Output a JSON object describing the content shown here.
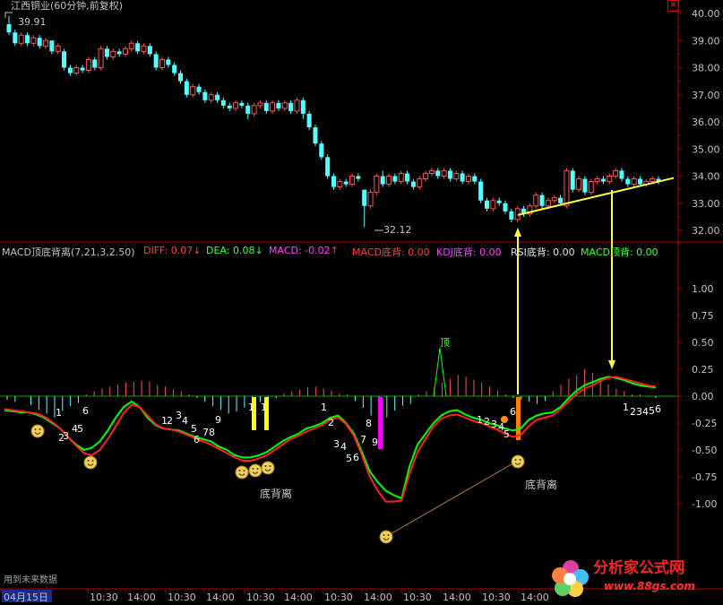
{
  "header": {
    "stock_title": "江西铜业(60分钟,前复权)",
    "close_symbol": "×"
  },
  "price_axis": [
    "40.00",
    "39.00",
    "38.00",
    "37.00",
    "36.00",
    "35.00",
    "34.00",
    "33.00",
    "32.00"
  ],
  "macd_axis": [
    "1.00",
    "0.75",
    "0.50",
    "0.25",
    "0.00",
    "-0.25",
    "-0.50",
    "-0.75",
    "-1.00"
  ],
  "time_axis": [
    "04月15日",
    "10:30",
    "14:00",
    "10:30",
    "14:00",
    "10:30",
    "14:00",
    "10:30",
    "14:00",
    "10:30",
    "14:00",
    "10:30",
    "14:00"
  ],
  "annotations": {
    "high_label": "39.91",
    "low_label": "32.12",
    "top_mark": "顶",
    "divergence_1": "底背离",
    "divergence_2": "底背离",
    "future_note": "用到未来数据"
  },
  "count_labels": {
    "g1": [
      "1",
      "2",
      "3",
      "4",
      "5",
      "6",
      "7"
    ],
    "g2": [
      "1",
      "2",
      "3",
      "4",
      "5",
      "6",
      "7",
      "8",
      "9"
    ],
    "g3": [
      "1",
      "1"
    ],
    "g4": [
      "1",
      "2",
      "3",
      "4",
      "5",
      "6",
      "7",
      "8",
      "9"
    ],
    "g5": [
      "1",
      "2",
      "3",
      "4",
      "5",
      "6"
    ],
    "g6": [
      "1",
      "2",
      "3",
      "4",
      "5",
      "6"
    ]
  },
  "indicator": {
    "name": "MACD顶底背离",
    "params": "(7,21,3,2.50)",
    "diff_label": "DIFF: 0.07",
    "dea_label": "DEA: 0.08",
    "macd_label": "MACD: -0.02",
    "macd_bottom": "MACD底背: 0.00",
    "kdj_bottom": "KDJ底背: 0.00",
    "rsi_bottom": "RSI底背: 0.00",
    "macd_top": "MACD顶背: 0.00",
    "diff_arrow": "↓",
    "dea_arrow": "↓",
    "macd_arrow": "↑"
  },
  "watermark": {
    "name": "分析家公式网",
    "url": "www.88gs.com"
  },
  "colors": {
    "up": "#ff5050",
    "down": "#54ffff",
    "diff": "#00ff00",
    "dea": "#ff2020",
    "macd_label": "#ff40ff",
    "trend": "#ffff40",
    "axis": "#b00000",
    "count": "#ffffff"
  },
  "chart_data": [
    {
      "type": "candlestick",
      "title": "江西铜业(60分钟,前复权)",
      "ylim": [
        31.7,
        40.1
      ],
      "price_high_marked": 39.91,
      "price_low_marked": 32.12,
      "candles": [
        {
          "o": 39.6,
          "c": 39.3,
          "h": 39.91,
          "l": 39.2
        },
        {
          "o": 39.3,
          "c": 38.9,
          "h": 39.4,
          "l": 38.8
        },
        {
          "o": 38.9,
          "c": 39.2,
          "h": 39.3,
          "l": 38.8
        },
        {
          "o": 39.2,
          "c": 38.9,
          "h": 39.3,
          "l": 38.8
        },
        {
          "o": 38.9,
          "c": 39.1,
          "h": 39.2,
          "l": 38.8
        },
        {
          "o": 39.1,
          "c": 38.8,
          "h": 39.2,
          "l": 38.7
        },
        {
          "o": 38.8,
          "c": 39.0,
          "h": 39.1,
          "l": 38.7
        },
        {
          "o": 39.0,
          "c": 38.6,
          "h": 39.0,
          "l": 38.5
        },
        {
          "o": 38.6,
          "c": 38.8,
          "h": 38.9,
          "l": 38.5
        },
        {
          "o": 38.6,
          "c": 38.0,
          "h": 38.7,
          "l": 37.9
        },
        {
          "o": 38.0,
          "c": 37.8,
          "h": 38.1,
          "l": 37.7
        },
        {
          "o": 37.8,
          "c": 38.0,
          "h": 38.1,
          "l": 37.7
        },
        {
          "o": 38.0,
          "c": 37.9,
          "h": 38.1,
          "l": 37.8
        },
        {
          "o": 37.9,
          "c": 38.3,
          "h": 38.4,
          "l": 37.8
        },
        {
          "o": 38.3,
          "c": 38.0,
          "h": 38.4,
          "l": 37.9
        },
        {
          "o": 38.0,
          "c": 38.7,
          "h": 38.8,
          "l": 37.9
        },
        {
          "o": 38.7,
          "c": 38.4,
          "h": 38.8,
          "l": 38.3
        },
        {
          "o": 38.4,
          "c": 38.6,
          "h": 38.7,
          "l": 38.3
        },
        {
          "o": 38.6,
          "c": 38.5,
          "h": 38.7,
          "l": 38.4
        },
        {
          "o": 38.5,
          "c": 38.7,
          "h": 38.8,
          "l": 38.4
        },
        {
          "o": 38.7,
          "c": 38.9,
          "h": 39.0,
          "l": 38.6
        },
        {
          "o": 38.9,
          "c": 38.6,
          "h": 39.0,
          "l": 38.5
        },
        {
          "o": 38.6,
          "c": 38.8,
          "h": 38.9,
          "l": 38.5
        },
        {
          "o": 38.8,
          "c": 38.5,
          "h": 38.9,
          "l": 38.4
        },
        {
          "o": 38.5,
          "c": 38.0,
          "h": 38.6,
          "l": 37.9
        },
        {
          "o": 38.0,
          "c": 38.3,
          "h": 38.4,
          "l": 37.9
        },
        {
          "o": 38.3,
          "c": 38.1,
          "h": 38.4,
          "l": 38.0
        },
        {
          "o": 38.1,
          "c": 37.8,
          "h": 38.2,
          "l": 37.7
        },
        {
          "o": 37.8,
          "c": 37.5,
          "h": 37.9,
          "l": 37.4
        },
        {
          "o": 37.5,
          "c": 37.0,
          "h": 37.6,
          "l": 36.9
        },
        {
          "o": 37.0,
          "c": 37.3,
          "h": 37.4,
          "l": 36.9
        },
        {
          "o": 37.3,
          "c": 37.1,
          "h": 37.4,
          "l": 37.0
        },
        {
          "o": 37.1,
          "c": 36.8,
          "h": 37.2,
          "l": 36.7
        },
        {
          "o": 36.8,
          "c": 37.0,
          "h": 37.1,
          "l": 36.7
        },
        {
          "o": 37.0,
          "c": 36.8,
          "h": 37.1,
          "l": 36.7
        },
        {
          "o": 36.8,
          "c": 36.6,
          "h": 36.9,
          "l": 36.5
        },
        {
          "o": 36.6,
          "c": 36.5,
          "h": 36.7,
          "l": 36.4
        },
        {
          "o": 36.5,
          "c": 36.7,
          "h": 36.8,
          "l": 36.4
        },
        {
          "o": 36.7,
          "c": 36.6,
          "h": 36.8,
          "l": 36.5
        },
        {
          "o": 36.6,
          "c": 36.3,
          "h": 36.7,
          "l": 36.1
        },
        {
          "o": 36.3,
          "c": 36.6,
          "h": 36.7,
          "l": 36.2
        },
        {
          "o": 36.6,
          "c": 36.7,
          "h": 36.8,
          "l": 36.5
        },
        {
          "o": 36.7,
          "c": 36.4,
          "h": 36.8,
          "l": 36.3
        },
        {
          "o": 36.4,
          "c": 36.7,
          "h": 36.8,
          "l": 36.3
        },
        {
          "o": 36.7,
          "c": 36.5,
          "h": 36.8,
          "l": 36.4
        },
        {
          "o": 36.5,
          "c": 36.7,
          "h": 36.8,
          "l": 36.4
        },
        {
          "o": 36.7,
          "c": 36.4,
          "h": 36.8,
          "l": 36.3
        },
        {
          "o": 36.4,
          "c": 36.8,
          "h": 36.9,
          "l": 36.3
        },
        {
          "o": 36.8,
          "c": 36.3,
          "h": 36.9,
          "l": 36.1
        },
        {
          "o": 36.3,
          "c": 35.8,
          "h": 36.4,
          "l": 35.7
        },
        {
          "o": 35.8,
          "c": 35.2,
          "h": 35.9,
          "l": 35.1
        },
        {
          "o": 35.2,
          "c": 34.7,
          "h": 35.3,
          "l": 34.6
        },
        {
          "o": 34.7,
          "c": 34.0,
          "h": 34.8,
          "l": 33.9
        },
        {
          "o": 34.0,
          "c": 33.6,
          "h": 34.1,
          "l": 33.5
        },
        {
          "o": 33.6,
          "c": 33.8,
          "h": 33.9,
          "l": 33.5
        },
        {
          "o": 33.8,
          "c": 33.7,
          "h": 33.9,
          "l": 33.6
        },
        {
          "o": 33.7,
          "c": 34.0,
          "h": 34.1,
          "l": 33.6
        },
        {
          "o": 34.0,
          "c": 33.9,
          "h": 34.1,
          "l": 33.8
        },
        {
          "o": 33.5,
          "c": 32.9,
          "h": 33.5,
          "l": 32.12
        },
        {
          "o": 32.9,
          "c": 33.4,
          "h": 33.5,
          "l": 32.8
        },
        {
          "o": 33.4,
          "c": 34.0,
          "h": 34.1,
          "l": 33.3
        },
        {
          "o": 34.0,
          "c": 33.7,
          "h": 34.2,
          "l": 33.6
        },
        {
          "o": 33.7,
          "c": 34.0,
          "h": 34.1,
          "l": 33.6
        },
        {
          "o": 34.0,
          "c": 33.8,
          "h": 34.1,
          "l": 33.7
        },
        {
          "o": 33.8,
          "c": 34.1,
          "h": 34.2,
          "l": 33.7
        },
        {
          "o": 34.1,
          "c": 33.8,
          "h": 34.2,
          "l": 33.7
        },
        {
          "o": 33.8,
          "c": 33.6,
          "h": 33.9,
          "l": 33.5
        },
        {
          "o": 33.6,
          "c": 33.9,
          "h": 34.0,
          "l": 33.5
        },
        {
          "o": 33.9,
          "c": 34.1,
          "h": 34.2,
          "l": 33.8
        },
        {
          "o": 34.1,
          "c": 34.2,
          "h": 34.3,
          "l": 34.0
        },
        {
          "o": 34.2,
          "c": 34.0,
          "h": 34.3,
          "l": 33.9
        },
        {
          "o": 34.0,
          "c": 34.2,
          "h": 34.3,
          "l": 33.9
        },
        {
          "o": 34.2,
          "c": 33.9,
          "h": 34.3,
          "l": 33.8
        },
        {
          "o": 33.9,
          "c": 34.1,
          "h": 34.2,
          "l": 33.8
        },
        {
          "o": 34.1,
          "c": 33.8,
          "h": 34.2,
          "l": 33.7
        },
        {
          "o": 33.8,
          "c": 34.0,
          "h": 34.1,
          "l": 33.7
        },
        {
          "o": 34.0,
          "c": 33.8,
          "h": 34.1,
          "l": 33.7
        },
        {
          "o": 33.8,
          "c": 33.1,
          "h": 33.9,
          "l": 33.0
        },
        {
          "o": 33.1,
          "c": 32.8,
          "h": 33.2,
          "l": 32.7
        },
        {
          "o": 32.8,
          "c": 33.1,
          "h": 33.2,
          "l": 32.7
        },
        {
          "o": 33.1,
          "c": 33.0,
          "h": 33.2,
          "l": 32.9
        },
        {
          "o": 33.0,
          "c": 32.7,
          "h": 33.1,
          "l": 32.6
        },
        {
          "o": 32.7,
          "c": 32.4,
          "h": 32.8,
          "l": 32.3
        },
        {
          "o": 32.4,
          "c": 32.8,
          "h": 32.9,
          "l": 32.3
        },
        {
          "o": 32.8,
          "c": 32.6,
          "h": 32.9,
          "l": 32.5
        },
        {
          "o": 32.6,
          "c": 32.9,
          "h": 33.0,
          "l": 32.5
        },
        {
          "o": 32.9,
          "c": 33.3,
          "h": 33.4,
          "l": 32.8
        },
        {
          "o": 33.3,
          "c": 32.9,
          "h": 33.4,
          "l": 32.8
        },
        {
          "o": 32.9,
          "c": 33.1,
          "h": 33.2,
          "l": 32.8
        },
        {
          "o": 33.1,
          "c": 33.2,
          "h": 33.3,
          "l": 33.0
        },
        {
          "o": 33.2,
          "c": 33.0,
          "h": 33.3,
          "l": 32.9
        },
        {
          "o": 32.9,
          "c": 34.2,
          "h": 34.3,
          "l": 32.8
        },
        {
          "o": 34.2,
          "c": 33.5,
          "h": 34.3,
          "l": 33.4
        },
        {
          "o": 33.5,
          "c": 33.9,
          "h": 34.0,
          "l": 33.4
        },
        {
          "o": 33.9,
          "c": 33.4,
          "h": 34.0,
          "l": 33.3
        },
        {
          "o": 33.4,
          "c": 33.8,
          "h": 33.9,
          "l": 33.3
        },
        {
          "o": 33.8,
          "c": 33.9,
          "h": 34.0,
          "l": 33.7
        },
        {
          "o": 33.9,
          "c": 33.8,
          "h": 34.0,
          "l": 33.7
        },
        {
          "o": 33.8,
          "c": 34.0,
          "h": 34.1,
          "l": 33.7
        },
        {
          "o": 34.0,
          "c": 34.2,
          "h": 34.3,
          "l": 33.9
        },
        {
          "o": 34.2,
          "c": 33.9,
          "h": 34.3,
          "l": 33.8
        },
        {
          "o": 33.9,
          "c": 33.7,
          "h": 34.0,
          "l": 33.6
        },
        {
          "o": 33.7,
          "c": 33.9,
          "h": 34.0,
          "l": 33.6
        },
        {
          "o": 33.9,
          "c": 33.7,
          "h": 34.0,
          "l": 33.6
        },
        {
          "o": 33.7,
          "c": 33.8,
          "h": 33.9,
          "l": 33.6
        },
        {
          "o": 33.8,
          "c": 33.9,
          "h": 34.0,
          "l": 33.7
        },
        {
          "o": 33.9,
          "c": 33.8,
          "h": 34.0,
          "l": 33.7
        }
      ],
      "trendline": {
        "from_price": 32.6,
        "to_price": 33.8
      }
    },
    {
      "type": "line",
      "title": "MACD顶底背离",
      "ylim": [
        -1.15,
        1.15
      ],
      "series": [
        {
          "name": "DIFF",
          "values": [
            -0.13,
            -0.14,
            -0.15,
            -0.15,
            -0.17,
            -0.2,
            -0.25,
            -0.3,
            -0.38,
            -0.45,
            -0.5,
            -0.48,
            -0.42,
            -0.32,
            -0.2,
            -0.1,
            -0.05,
            -0.1,
            -0.2,
            -0.27,
            -0.3,
            -0.31,
            -0.32,
            -0.35,
            -0.38,
            -0.4,
            -0.42,
            -0.47,
            -0.5,
            -0.55,
            -0.57,
            -0.57,
            -0.55,
            -0.52,
            -0.47,
            -0.42,
            -0.38,
            -0.35,
            -0.3,
            -0.28,
            -0.25,
            -0.2,
            -0.18,
            -0.25,
            -0.35,
            -0.52,
            -0.7,
            -0.8,
            -0.88,
            -0.92,
            -0.95,
            -0.65,
            -0.45,
            -0.35,
            -0.25,
            -0.18,
            -0.14,
            -0.13,
            -0.17,
            -0.2,
            -0.22,
            -0.25,
            -0.27,
            -0.3,
            -0.32,
            -0.3,
            -0.22,
            -0.18,
            -0.16,
            -0.15,
            -0.1,
            -0.02,
            0.05,
            0.1,
            0.13,
            0.16,
            0.18,
            0.17,
            0.15,
            0.12,
            0.1,
            0.09,
            0.08
          ]
        },
        {
          "name": "DEA",
          "values": [
            -0.12,
            -0.13,
            -0.14,
            -0.15,
            -0.16,
            -0.19,
            -0.24,
            -0.3,
            -0.38,
            -0.46,
            -0.53,
            -0.55,
            -0.5,
            -0.4,
            -0.28,
            -0.16,
            -0.08,
            -0.1,
            -0.18,
            -0.26,
            -0.3,
            -0.31,
            -0.33,
            -0.36,
            -0.39,
            -0.42,
            -0.45,
            -0.49,
            -0.53,
            -0.57,
            -0.6,
            -0.6,
            -0.58,
            -0.55,
            -0.5,
            -0.45,
            -0.4,
            -0.37,
            -0.33,
            -0.3,
            -0.27,
            -0.22,
            -0.2,
            -0.26,
            -0.37,
            -0.55,
            -0.75,
            -0.88,
            -0.98,
            -0.98,
            -0.97,
            -0.72,
            -0.52,
            -0.4,
            -0.28,
            -0.21,
            -0.18,
            -0.17,
            -0.2,
            -0.23,
            -0.25,
            -0.28,
            -0.31,
            -0.35,
            -0.38,
            -0.36,
            -0.28,
            -0.22,
            -0.2,
            -0.18,
            -0.12,
            -0.05,
            0.02,
            0.07,
            0.1,
            0.14,
            0.17,
            0.18,
            0.16,
            0.14,
            0.12,
            0.1,
            0.09
          ]
        }
      ],
      "histogram": [
        -0.04,
        -0.06,
        0.0,
        -0.09,
        -0.14,
        -0.18,
        -0.22,
        -0.15,
        -0.1,
        -0.07,
        0.02,
        0.05,
        0.08,
        0.1,
        0.12,
        0.14,
        0.15,
        0.16,
        0.15,
        0.12,
        0.1,
        0.07,
        0.05,
        0.02,
        -0.02,
        -0.06,
        -0.1,
        -0.14,
        -0.18,
        -0.16,
        -0.12,
        -0.08,
        -0.06,
        -0.04,
        -0.02,
        0.03,
        0.05,
        0.07,
        0.09,
        0.1,
        0.08,
        0.06,
        0.03,
        0.02,
        -0.05,
        -0.12,
        -0.2,
        -0.28,
        -0.22,
        -0.15,
        -0.1,
        -0.08,
        0.02,
        0.05,
        0.09,
        0.14,
        0.18,
        0.22,
        0.2,
        0.17,
        0.14,
        0.1,
        0.06,
        0.02,
        -0.02,
        -0.04,
        -0.06,
        -0.08,
        -0.05,
        0.05,
        0.12,
        0.18,
        0.22,
        0.28,
        0.24,
        0.18,
        0.12,
        0.08,
        0.05,
        0.02,
        0.02,
        0.01,
        -0.02
      ],
      "markers": {
        "yellow_bars": [
          0.0,
          0.0
        ],
        "magenta_bar": 0.0,
        "orange_bar": 0.0,
        "divergence_low_1": -0.95,
        "divergence_low_2": -0.6
      }
    }
  ]
}
